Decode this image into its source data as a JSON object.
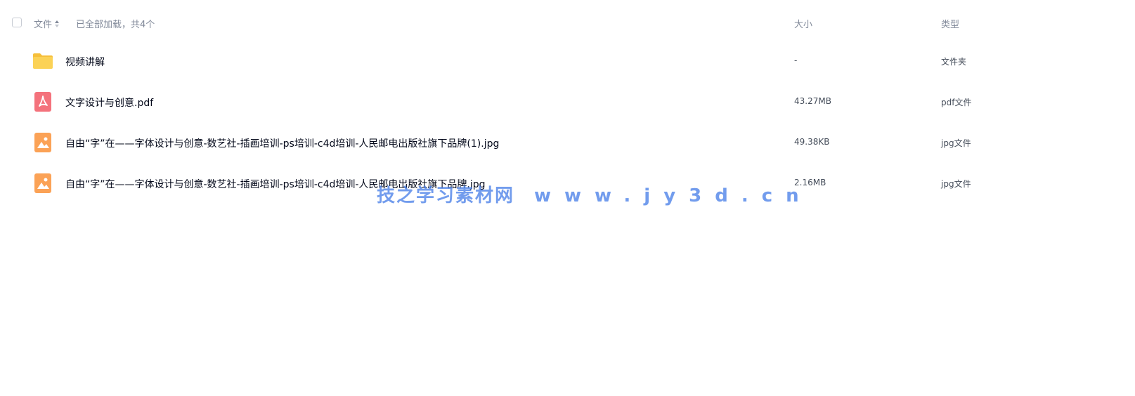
{
  "header": {
    "name_label": "文件",
    "load_status": "已全部加载，共4个",
    "size_label": "大小",
    "type_label": "类型"
  },
  "files": [
    {
      "name": "视频讲解",
      "size": "-",
      "type": "文件夹",
      "icon": "folder-icon"
    },
    {
      "name": "文字设计与创意.pdf",
      "size": "43.27MB",
      "type": "pdf文件",
      "icon": "pdf-icon"
    },
    {
      "name": "自由“字”在——字体设计与创意-数艺社-插画培训-ps培训-c4d培训-人民邮电出版社旗下品牌(1).jpg",
      "size": "49.38KB",
      "type": "jpg文件",
      "icon": "image-icon"
    },
    {
      "name": "自由“字”在——字体设计与创意-数艺社-插画培训-ps培训-c4d培训-人民邮电出版社旗下品牌.jpg",
      "size": "2.16MB",
      "type": "jpg文件",
      "icon": "image-icon"
    }
  ],
  "watermark": {
    "site_name": "技之学习素材网",
    "url": "www.jy3d.cn"
  },
  "colors": {
    "folder": "#fbd256",
    "pdf": "#f4727c",
    "image": "#fba256",
    "watermark": "#4a80e8"
  }
}
